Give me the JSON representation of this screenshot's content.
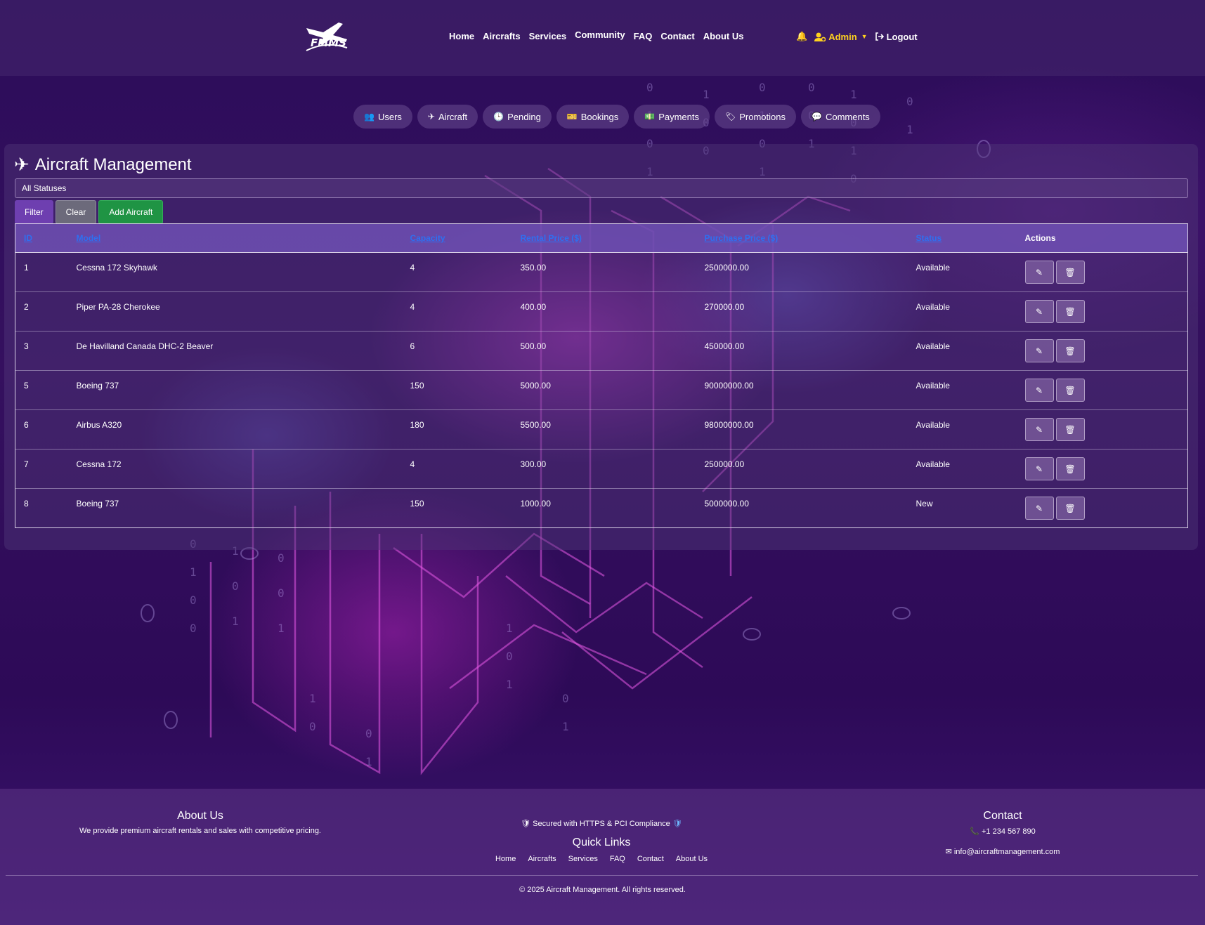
{
  "header": {
    "logo_text": "FMMS",
    "nav": [
      "Home",
      "Aircrafts",
      "Services",
      "Community",
      "FAQ",
      "Contact",
      "About Us"
    ],
    "user_label": "Admin",
    "logout_label": "Logout"
  },
  "tabs": [
    {
      "label": "Users",
      "icon": "users-icon"
    },
    {
      "label": "Aircraft",
      "icon": "plane-icon"
    },
    {
      "label": "Pending",
      "icon": "clock-icon"
    },
    {
      "label": "Bookings",
      "icon": "ticket-icon"
    },
    {
      "label": "Payments",
      "icon": "money-icon"
    },
    {
      "label": "Promotions",
      "icon": "tag-icon"
    },
    {
      "label": "Comments",
      "icon": "comments-icon"
    }
  ],
  "panel": {
    "title": "Aircraft Management",
    "status_select": "All Statuses",
    "filter_label": "Filter",
    "clear_label": "Clear",
    "add_label": "Add Aircraft"
  },
  "table": {
    "columns": [
      "ID",
      "Model",
      "Capacity",
      "Rental Price ($)",
      "Purchase Price ($)",
      "Status",
      "Actions"
    ],
    "rows": [
      [
        "1",
        "Cessna 172 Skyhawk",
        "4",
        "350.00",
        "2500000.00",
        "Available"
      ],
      [
        "2",
        "Piper PA-28 Cherokee",
        "4",
        "400.00",
        "270000.00",
        "Available"
      ],
      [
        "3",
        "De Havilland Canada DHC-2 Beaver",
        "6",
        "500.00",
        "450000.00",
        "Available"
      ],
      [
        "5",
        "Boeing 737",
        "150",
        "5000.00",
        "90000000.00",
        "Available"
      ],
      [
        "6",
        "Airbus A320",
        "180",
        "5500.00",
        "98000000.00",
        "Available"
      ],
      [
        "7",
        "Cessna 172",
        "4",
        "300.00",
        "250000.00",
        "Available"
      ],
      [
        "8",
        "Boeing 737",
        "150",
        "1000.00",
        "5000000.00",
        "New"
      ]
    ]
  },
  "footer": {
    "about_title": "About Us",
    "about_text": "We provide premium aircraft rentals and sales with competitive pricing.",
    "secure_text": "Secured with HTTPS & PCI Compliance",
    "quick_title": "Quick Links",
    "quick_links": [
      "Home",
      "Aircrafts",
      "Services",
      "FAQ",
      "Contact",
      "About Us"
    ],
    "contact_title": "Contact",
    "phone": "+1 234 567 890",
    "email": "info@aircraftmanagement.com",
    "copyright": "© 2025 Aircraft Management. All rights reserved."
  },
  "colors": {
    "accent": "#6e3fb0",
    "admin": "#ffd21e",
    "add_button": "#1f9444",
    "sort_link": "#2f6ff0"
  }
}
